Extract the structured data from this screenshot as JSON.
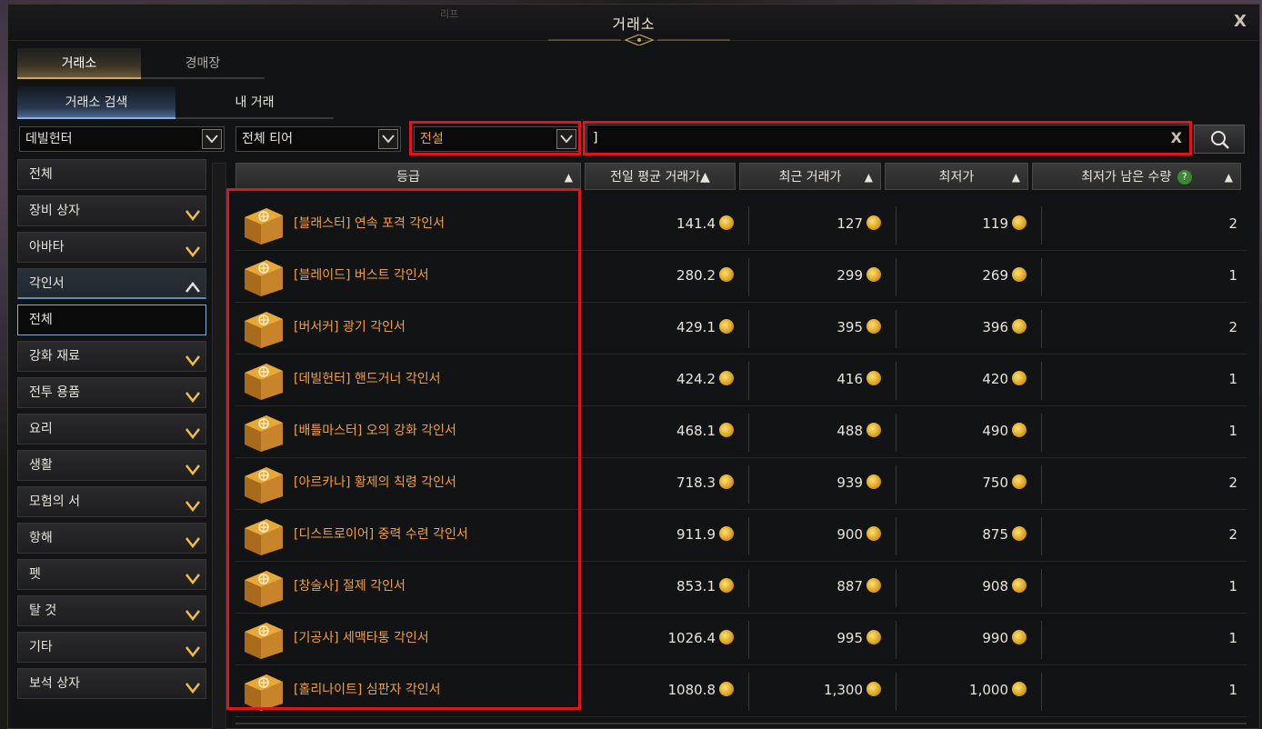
{
  "window": {
    "title": "거래소",
    "ghost_text": "리프",
    "close_label": "X"
  },
  "tabs_primary": [
    {
      "label": "거래소",
      "active": true
    },
    {
      "label": "경매장",
      "active": false
    }
  ],
  "tabs_secondary": [
    {
      "label": "거래소 검색",
      "active": true
    },
    {
      "label": "내 거래",
      "active": false
    }
  ],
  "filters": {
    "class_select": "데빌헌터",
    "tier_select": "전체 티어",
    "grade_select": "전설",
    "search_value": "]",
    "search_clear": "X"
  },
  "sidebar": [
    {
      "label": "전체",
      "chevron": "none"
    },
    {
      "label": "장비 상자",
      "chevron": "down"
    },
    {
      "label": "아바타",
      "chevron": "down"
    },
    {
      "label": "각인서",
      "chevron": "up",
      "state": "open"
    },
    {
      "label": "전체",
      "chevron": "none",
      "state": "selected"
    },
    {
      "label": "강화 재료",
      "chevron": "down"
    },
    {
      "label": "전투 용품",
      "chevron": "down"
    },
    {
      "label": "요리",
      "chevron": "down"
    },
    {
      "label": "생활",
      "chevron": "down"
    },
    {
      "label": "모험의 서",
      "chevron": "down"
    },
    {
      "label": "항해",
      "chevron": "down"
    },
    {
      "label": "펫",
      "chevron": "down"
    },
    {
      "label": "탈 것",
      "chevron": "down"
    },
    {
      "label": "기타",
      "chevron": "down"
    },
    {
      "label": "보석 상자",
      "chevron": "down"
    }
  ],
  "table": {
    "headers": {
      "grade": "등급",
      "prev_avg": "전일 평균 거래가",
      "recent": "최근 거래가",
      "lowest": "최저가",
      "lowest_qty": "최저가 남은 수량",
      "help": "?",
      "sort_icon": "▲"
    },
    "rows": [
      {
        "name": "[블래스터] 연속 포격 각인서",
        "prev_avg": "141.4",
        "recent": "127",
        "lowest": "119",
        "qty": "2"
      },
      {
        "name": "[블레이드] 버스트 각인서",
        "prev_avg": "280.2",
        "recent": "299",
        "lowest": "269",
        "qty": "1"
      },
      {
        "name": "[버서커] 광기 각인서",
        "prev_avg": "429.1",
        "recent": "395",
        "lowest": "396",
        "qty": "2"
      },
      {
        "name": "[데빌헌터] 핸드거너 각인서",
        "prev_avg": "424.2",
        "recent": "416",
        "lowest": "420",
        "qty": "1"
      },
      {
        "name": "[배틀마스터] 오의 강화 각인서",
        "prev_avg": "468.1",
        "recent": "488",
        "lowest": "490",
        "qty": "1"
      },
      {
        "name": "[아르카나] 황제의 칙령 각인서",
        "prev_avg": "718.3",
        "recent": "939",
        "lowest": "750",
        "qty": "2"
      },
      {
        "name": "[디스트로이어] 중력 수련 각인서",
        "prev_avg": "911.9",
        "recent": "900",
        "lowest": "875",
        "qty": "2"
      },
      {
        "name": "[창술사] 절제 각인서",
        "prev_avg": "853.1",
        "recent": "887",
        "lowest": "908",
        "qty": "1"
      },
      {
        "name": "[기공사] 세맥타통 각인서",
        "prev_avg": "1026.4",
        "recent": "995",
        "lowest": "990",
        "qty": "1"
      },
      {
        "name": "[홀리나이트] 심판자 각인서",
        "prev_avg": "1080.8",
        "recent": "1,300",
        "lowest": "1,000",
        "qty": "1"
      }
    ]
  },
  "colors": {
    "legend_orange": "#f0a040",
    "highlight_red": "#e0141c",
    "coin_gold": "#d8a020"
  },
  "icons": {
    "close": "close-icon",
    "dropdown": "chevron-down-icon",
    "search": "search-icon",
    "item": "engraving-book-icon",
    "coin": "gold-coin-icon"
  }
}
